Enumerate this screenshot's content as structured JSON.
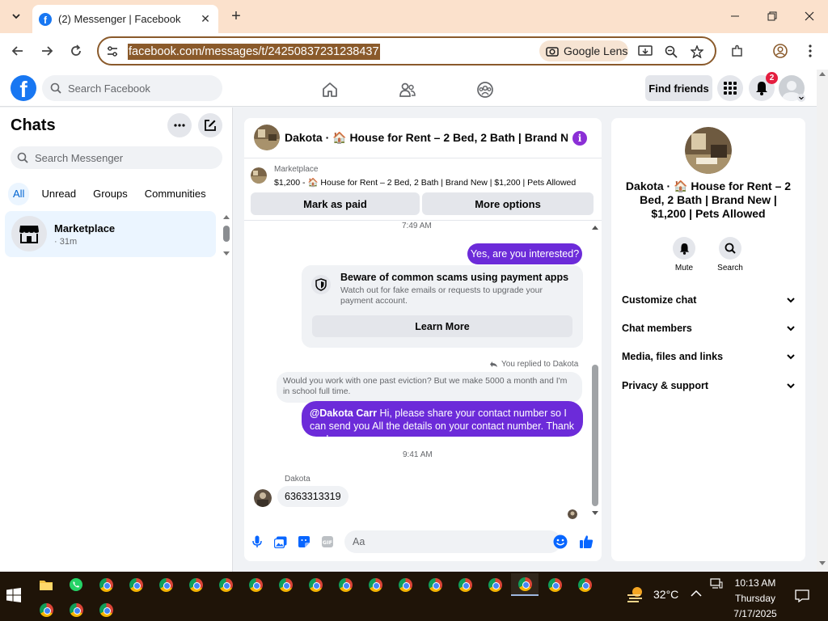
{
  "browser": {
    "tab_title": "(2) Messenger | Facebook",
    "url": "facebook.com/messages/t/24250837231238437",
    "lens_label": "Google Lens"
  },
  "facebook": {
    "search_placeholder": "Search Facebook",
    "find_friends_label": "Find friends",
    "notification_count": "2"
  },
  "chats": {
    "title": "Chats",
    "search_placeholder": "Search Messenger",
    "filters": [
      "All",
      "Unread",
      "Groups",
      "Communities"
    ],
    "active_filter": "All",
    "items": [
      {
        "name": "Marketplace",
        "meta": "· 31m"
      }
    ]
  },
  "conversation": {
    "title": "Dakota · 🏠 House for Rent – 2 Bed, 2 Bath | Brand Ne...",
    "listing_source": "Marketplace",
    "listing_desc": "$1,200 - 🏠 House for Rent – 2 Bed, 2 Bath | Brand New | $1,200 | Pets Allowed",
    "mark_paid_label": "Mark as paid",
    "more_options_label": "More options",
    "time_1": "7:49 AM",
    "my_msg_1": "Yes, are you interested?",
    "warning_title": "Beware of common scams using payment apps",
    "warning_desc": "Watch out for fake emails or requests to upgrade your payment account.",
    "learn_more_label": "Learn More",
    "replied_label": "You replied to Dakota",
    "quoted_msg": "Would you work with one past eviction? But we make 5000 a month and I'm in school full time.",
    "my_msg_2_mention": "@Dakota Carr",
    "my_msg_2_text": " Hi, please share your contact number so I can send you All the details on your contact number. Thank you!",
    "time_2": "9:41 AM",
    "sender_name": "Dakota",
    "their_msg": "6363313319",
    "composer_placeholder": "Aa"
  },
  "info_panel": {
    "name": "Dakota · 🏠 House for Rent – 2 Bed, 2 Bath | Brand New | $1,200 | Pets Allowed",
    "mute_label": "Mute",
    "search_label": "Search",
    "sections": [
      "Customize chat",
      "Chat members",
      "Media, files and links",
      "Privacy & support"
    ]
  },
  "taskbar": {
    "temperature": "32°C",
    "time": "10:13 AM",
    "day": "Thursday",
    "date": "7/17/2025"
  },
  "colors": {
    "accent_blue": "#1877f2",
    "my_bubble": "#6c2bd9",
    "info_purple": "#8b2fd6",
    "tab_strip": "#fbe1cc",
    "url_highlight": "#8a5a2b"
  }
}
